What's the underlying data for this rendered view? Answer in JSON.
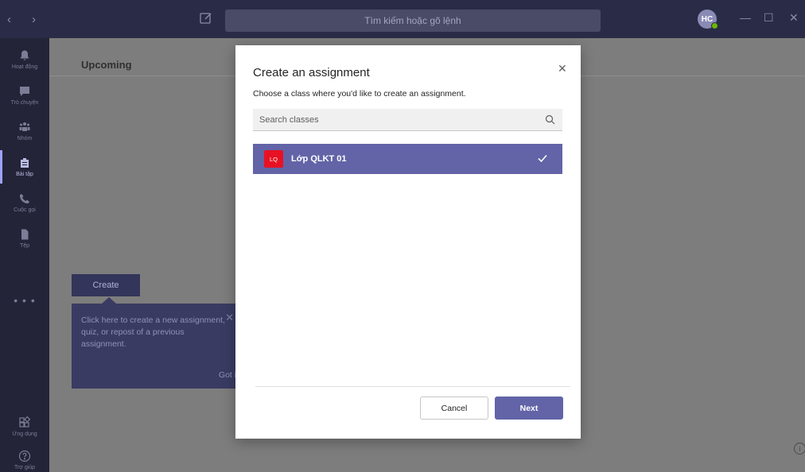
{
  "titlebar": {
    "back_icon": "chevron-left-icon",
    "forward_icon": "chevron-right-icon",
    "search_placeholder": "Tìm kiếm hoặc gõ lệnh",
    "avatar_initials": "HC"
  },
  "leftrail": {
    "items": [
      {
        "label": "Hoạt động",
        "icon": "bell-icon"
      },
      {
        "label": "Trò chuyện",
        "icon": "chat-icon"
      },
      {
        "label": "Nhóm",
        "icon": "teams-icon"
      },
      {
        "label": "Bài tập",
        "icon": "assignment-icon",
        "active": true
      },
      {
        "label": "Cuộc gọi",
        "icon": "phone-icon"
      },
      {
        "label": "Tệp",
        "icon": "file-icon"
      }
    ],
    "more": "• • •",
    "apps_label": "Ứng dụng",
    "help_label": "Trợ giúp"
  },
  "main": {
    "heading": "Upcoming",
    "create_label": "Create",
    "tooltip_text": "Click here to create a new assignment, quiz, or repost of a previous assignment.",
    "tooltip_action": "Got it"
  },
  "modal": {
    "title": "Create an assignment",
    "subtitle": "Choose a class where you'd like to create an assignment.",
    "search_placeholder": "Search classes",
    "classes": [
      {
        "badge": "LQ",
        "name": "Lớp QLKT 01",
        "selected": true
      }
    ],
    "cancel_label": "Cancel",
    "next_label": "Next"
  },
  "colors": {
    "accent": "#6264a7",
    "titlebar": "#2a2b46",
    "rail": "#232438",
    "badge": "#e81123"
  }
}
